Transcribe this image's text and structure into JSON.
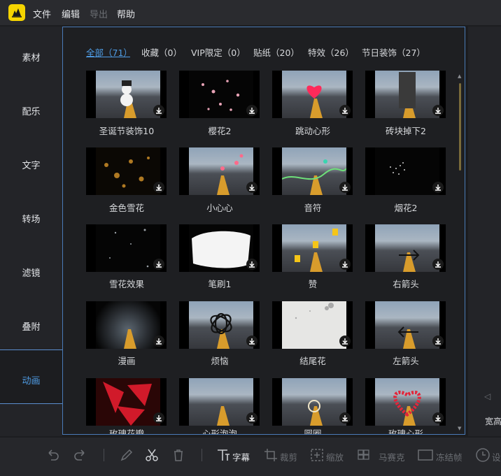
{
  "menu": {
    "file": "文件",
    "edit": "编辑",
    "export": "导出",
    "help": "帮助"
  },
  "sidebar": {
    "items": [
      {
        "label": "素材"
      },
      {
        "label": "配乐"
      },
      {
        "label": "文字"
      },
      {
        "label": "转场"
      },
      {
        "label": "滤镜"
      },
      {
        "label": "叠附"
      },
      {
        "label": "动画"
      }
    ],
    "active": "动画"
  },
  "categories": [
    {
      "label": "全部（71）",
      "active": true
    },
    {
      "label": "收藏（0）"
    },
    {
      "label": "VIP限定（0）"
    },
    {
      "label": "贴纸（20）"
    },
    {
      "label": "特效（26）"
    },
    {
      "label": "节日装饰（27）"
    }
  ],
  "items": [
    {
      "label": "圣诞节装饰10"
    },
    {
      "label": "樱花2"
    },
    {
      "label": "跳动心形"
    },
    {
      "label": "砖块掉下2"
    },
    {
      "label": "金色雪花"
    },
    {
      "label": "小心心"
    },
    {
      "label": "音符"
    },
    {
      "label": "烟花2"
    },
    {
      "label": "雪花效果"
    },
    {
      "label": "笔刷1"
    },
    {
      "label": "赞"
    },
    {
      "label": "右箭头"
    },
    {
      "label": "漫画"
    },
    {
      "label": "烦恼"
    },
    {
      "label": "结尾花"
    },
    {
      "label": "左箭头"
    },
    {
      "label": "玫瑰花瓣"
    },
    {
      "label": "心形泡泡"
    },
    {
      "label": "圆圈"
    },
    {
      "label": "玫瑰心形"
    }
  ],
  "right_panel": {
    "label": "宽高"
  },
  "toolbar": {
    "subtitle": "字幕",
    "crop": "裁剪",
    "zoom": "缩放",
    "mosaic": "马赛克",
    "freeze": "冻结帧",
    "settings": "设"
  },
  "colors": {
    "accent": "#4f9de6",
    "logo": "#f5d400",
    "panel_border": "#4a7bb8"
  }
}
